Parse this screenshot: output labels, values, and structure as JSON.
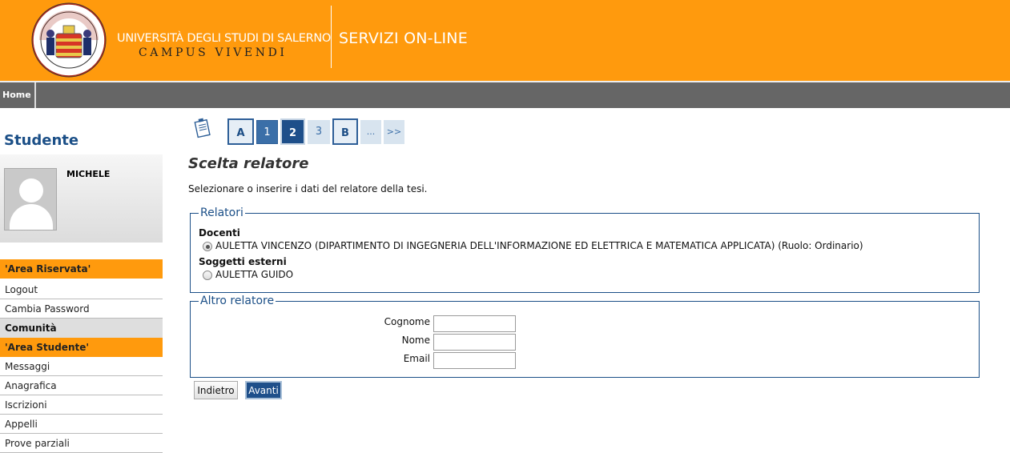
{
  "header": {
    "seal_text": "HIPPOCRATICA CIVITAS STUDIUM SALERNI",
    "university": "UNIVERSITÀ DEGLI STUDI DI SALERNO",
    "motto": "CAMPUS VIVENDI",
    "services": "SERVIZI ON-LINE"
  },
  "nav": {
    "home": "Home"
  },
  "sidebar": {
    "title": "Studente",
    "user_name": "MICHELE",
    "area_riservata": "'Area Riservata'",
    "logout": "Logout",
    "change_password": "Cambia Password",
    "community": "Comunità",
    "area_studente": "'Area Studente'",
    "items": [
      "Messaggi",
      "Anagrafica",
      "Iscrizioni",
      "Appelli",
      "Prove parziali"
    ]
  },
  "wizard": {
    "steps": [
      "A",
      "1",
      "2",
      "3",
      "B",
      "...",
      ">>"
    ],
    "current_step": "2"
  },
  "main": {
    "title": "Scelta relatore",
    "intro": "Selezionare o inserire i dati del relatore della tesi.",
    "relatori_legend": "Relatori",
    "docenti_label": "Docenti",
    "docente_option": "AULETTA VINCENZO (DIPARTIMENTO DI INGEGNERIA DELL'INFORMAZIONE ED ELETTRICA E MATEMATICA APPLICATA) (Ruolo: Ordinario)",
    "docente_selected": true,
    "esterni_label": "Soggetti esterni",
    "esterno_option": "AULETTA GUIDO",
    "esterno_selected": false,
    "altro_legend": "Altro relatore",
    "fields": [
      {
        "label": "Cognome",
        "value": ""
      },
      {
        "label": "Nome",
        "value": ""
      },
      {
        "label": "Email",
        "value": ""
      }
    ],
    "back_label": "Indietro",
    "next_label": "Avanti"
  },
  "colors": {
    "header_orange": "#ff9a0d",
    "nav_gray": "#666666",
    "accent_blue": "#1e4f8a"
  }
}
